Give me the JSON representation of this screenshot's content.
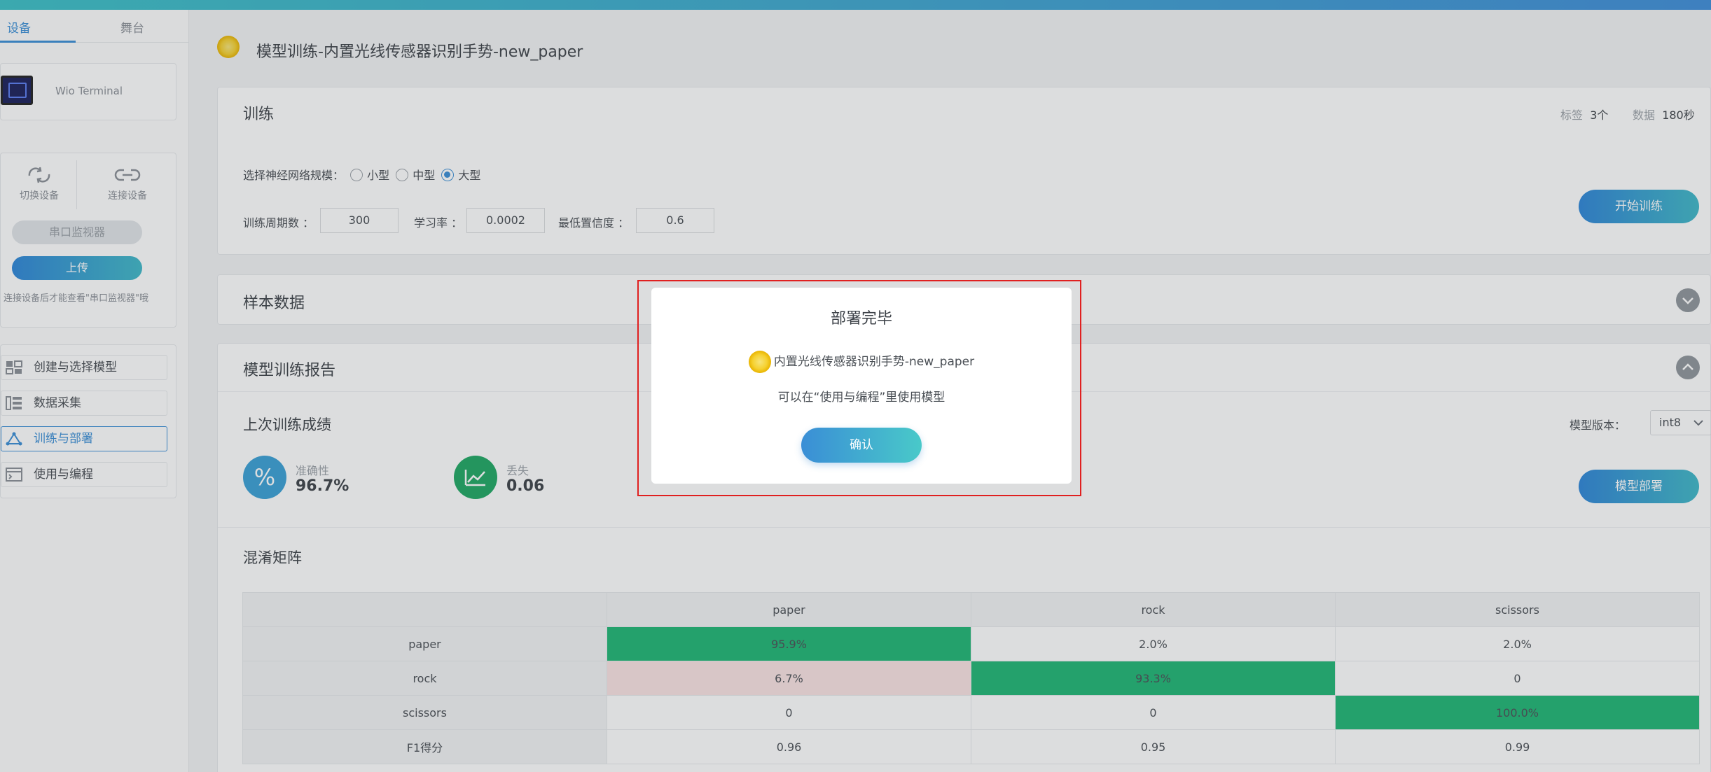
{
  "sidebar": {
    "tabs": [
      "设备",
      "舞台"
    ],
    "device_name": "Wio Terminal",
    "switch_device": "切换设备",
    "connect_device": "连接设备",
    "serial_monitor": "串口监视器",
    "upload": "上传",
    "hint": "连接设备后才能查看\"串口监视器\"哦",
    "nav": [
      {
        "label": "创建与选择模型",
        "icon": "model-icon"
      },
      {
        "label": "数据采集",
        "icon": "data-icon"
      },
      {
        "label": "训练与部署",
        "icon": "train-icon",
        "active": true
      },
      {
        "label": "使用与编程",
        "icon": "code-icon"
      }
    ]
  },
  "header": {
    "title": "模型训练-内置光线传感器识别手势-new_paper"
  },
  "training": {
    "title": "训练",
    "labels_key": "标签",
    "labels_val": "3个",
    "data_key": "数据",
    "data_val": "180秒",
    "scale_label": "选择神经网络规模：",
    "scale_options": [
      "小型",
      "中型",
      "大型"
    ],
    "scale_selected": "大型",
    "epochs_label": "训练周期数 ：",
    "epochs": "300",
    "lr_label": "学习率 ：",
    "lr": "0.0002",
    "conf_label": "最低置信度 ：",
    "conf": "0.6",
    "start_btn": "开始训练"
  },
  "samples": {
    "title": "样本数据"
  },
  "report": {
    "title": "模型训练报告",
    "last_result": "上次训练成绩",
    "accuracy_label": "准确性",
    "accuracy": "96.7%",
    "loss_label": "丢失",
    "loss": "0.06",
    "version_label": "模型版本：",
    "version": "int8",
    "deploy_btn": "模型部署",
    "matrix_title": "混淆矩阵",
    "matrix": {
      "columns": [
        "paper",
        "rock",
        "scissors"
      ],
      "rows": [
        {
          "label": "paper",
          "values": [
            "95.9%",
            "2.0%",
            "2.0%"
          ]
        },
        {
          "label": "rock",
          "values": [
            "6.7%",
            "93.3%",
            "0"
          ]
        },
        {
          "label": "scissors",
          "values": [
            "0",
            "0",
            "100.0%"
          ]
        },
        {
          "label": "F1得分",
          "values": [
            "0.96",
            "0.95",
            "0.99"
          ]
        }
      ]
    }
  },
  "modal": {
    "title": "部署完毕",
    "model_name": "内置光线传感器识别手势-new_paper",
    "message": "可以在“使用与编程”里使用模型",
    "confirm": "确认"
  },
  "colors": {
    "accent": "#3a8ed6",
    "green": "#1fb675",
    "pink": "#fbe3e3",
    "alert_red": "#e02020"
  }
}
